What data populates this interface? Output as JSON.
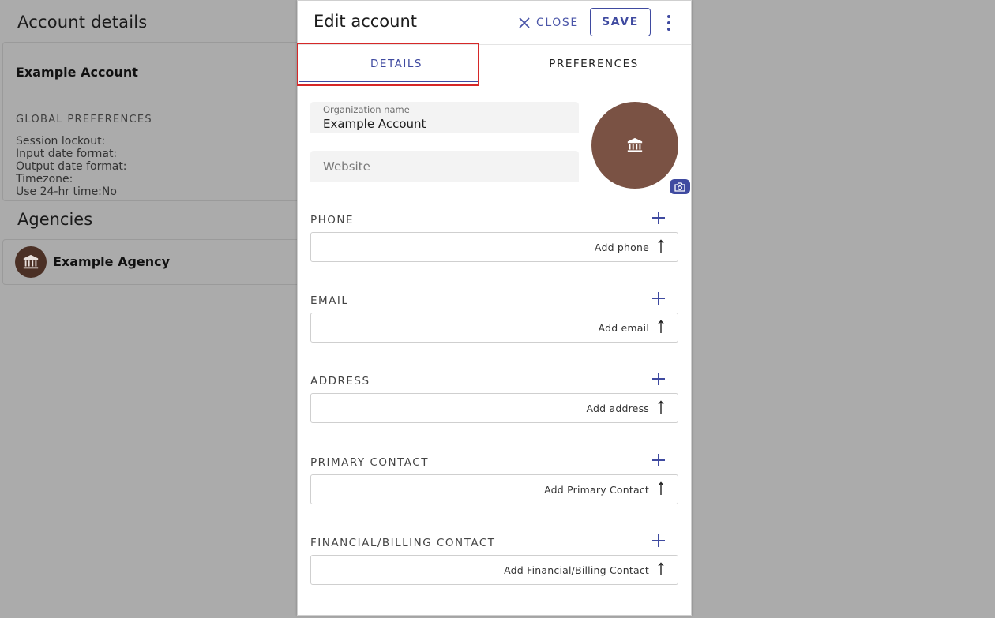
{
  "background": {
    "title": "Account details",
    "account_name": "Example Account",
    "global_preferences_label": "GLOBAL PREFERENCES",
    "preferences": [
      "Session lockout:",
      "Input date format:",
      "Output date format:",
      "Timezone:",
      "Use 24-hr time:No"
    ],
    "agencies_title": "Agencies",
    "agency_name": "Example Agency"
  },
  "modal": {
    "title": "Edit account",
    "close_label": "CLOSE",
    "save_label": "SAVE",
    "tabs": [
      {
        "label": "DETAILS",
        "active": true
      },
      {
        "label": "PREFERENCES",
        "active": false
      }
    ],
    "org_name_label": "Organization name",
    "org_name_value": "Example Account",
    "website_placeholder": "Website",
    "sections": [
      {
        "label": "PHONE",
        "add_text": "Add phone"
      },
      {
        "label": "EMAIL",
        "add_text": "Add email"
      },
      {
        "label": "ADDRESS",
        "add_text": "Add address"
      },
      {
        "label": "PRIMARY CONTACT",
        "add_text": "Add Primary Contact"
      },
      {
        "label": "FINANCIAL/BILLING CONTACT",
        "add_text": "Add Financial/Billing Contact"
      }
    ]
  },
  "icons": {
    "close": "close-icon",
    "more": "more-vertical-icon",
    "avatar": "bank-icon",
    "camera": "camera-icon",
    "add": "plus-icon",
    "arrow": "arrow-up-icon"
  },
  "colors": {
    "accent": "#3f4aa0",
    "highlight": "#d62828",
    "avatar_bg": "#7a5244",
    "overlay_bg": "#ababab"
  }
}
